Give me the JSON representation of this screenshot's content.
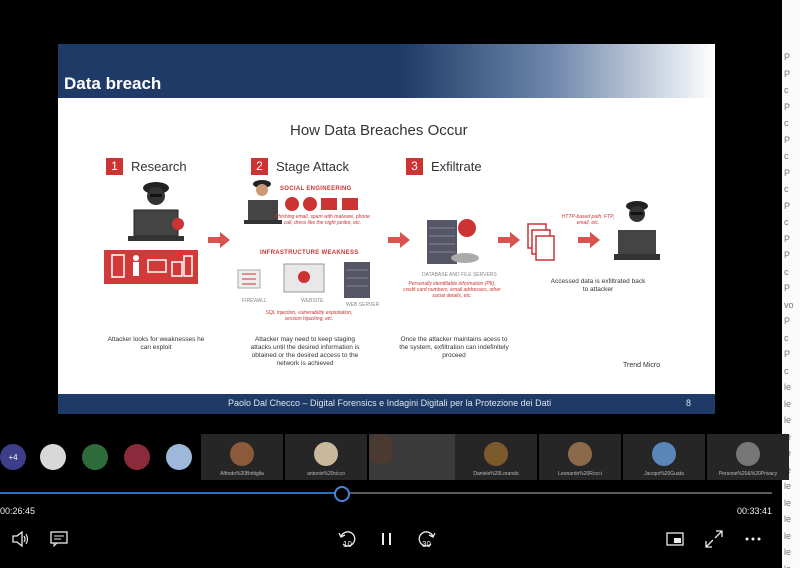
{
  "slide": {
    "title": "Data breach",
    "infographic_title": "How Data Breaches Occur",
    "steps": [
      {
        "num": "1",
        "label": "Research"
      },
      {
        "num": "2",
        "label": "Stage Attack"
      },
      {
        "num": "3",
        "label": "Exfiltrate"
      }
    ],
    "social_engineering": "SOCIAL ENGINEERING",
    "social_engineering_desc": "Phishing email, spam with malware, phone call, dress like the night janitor, etc.",
    "infrastructure_weakness": "INFRASTRUCTURE WEAKNESS",
    "infrastructure_desc": "SQL injection, vulnerability exploitation, session hijacking, etc.",
    "firewall": "FIREWALL",
    "website": "WEBSITE",
    "web_server": "WEB SERVER",
    "database_label": "DATABASE AND FILE SERVERS",
    "database_desc": "Personally identifiable information (PII), credit card numbers, email addresses, other social details, etc.",
    "http_desc": "HTTP-based path, FTP, email, etc.",
    "exfil_note": "Accessed data is exfiltrated back to attacker",
    "caption_research": "Attacker looks for weaknesses he can exploit",
    "caption_stage": "Attacker may need to keep staging attacks until the desired information is obtained or the desired access to the network is achieved",
    "caption_exfil": "Once the attacker maintains acess to the system, exfiltration can indefinitely proceed",
    "credit": "Trend Micro",
    "footer": "Paolo Dal Checco – Digital Forensics e Indagini Digitali per la Protezione dei Dati",
    "page": "8"
  },
  "participants": {
    "more": "+4",
    "tiles": [
      {
        "name": "Alfredo%20Bottiglia",
        "color": "#8a5a3a"
      },
      {
        "name": "antonio%20cicco",
        "color": "#c9b89c"
      },
      {
        "name": "",
        "color": "#4a3a30"
      },
      {
        "name": "Daniele%20Lorando",
        "color": "#7a5a2a"
      },
      {
        "name": "Leonardo%20Rocci",
        "color": "#8a6a4a"
      },
      {
        "name": "Jacopo%20Guata",
        "color": "#5a86b8"
      },
      {
        "name": "Persone%20&%20Privacy",
        "color": "#777777"
      }
    ]
  },
  "player": {
    "current_time": "00:26:45",
    "total_time": "00:33:41",
    "progress": 0.443,
    "skip_back": "10",
    "skip_forward": "30"
  },
  "side_panel_lines": [
    "P",
    "P",
    "c",
    "P",
    "c",
    "P",
    "c",
    "P",
    "c",
    "P",
    "c",
    "P",
    "P",
    "c",
    "P",
    "vo",
    "P",
    "c",
    "P",
    "c",
    "le",
    "le",
    "le",
    "le",
    "le",
    "le",
    "le",
    "le",
    "le",
    "le",
    "le",
    "le"
  ]
}
